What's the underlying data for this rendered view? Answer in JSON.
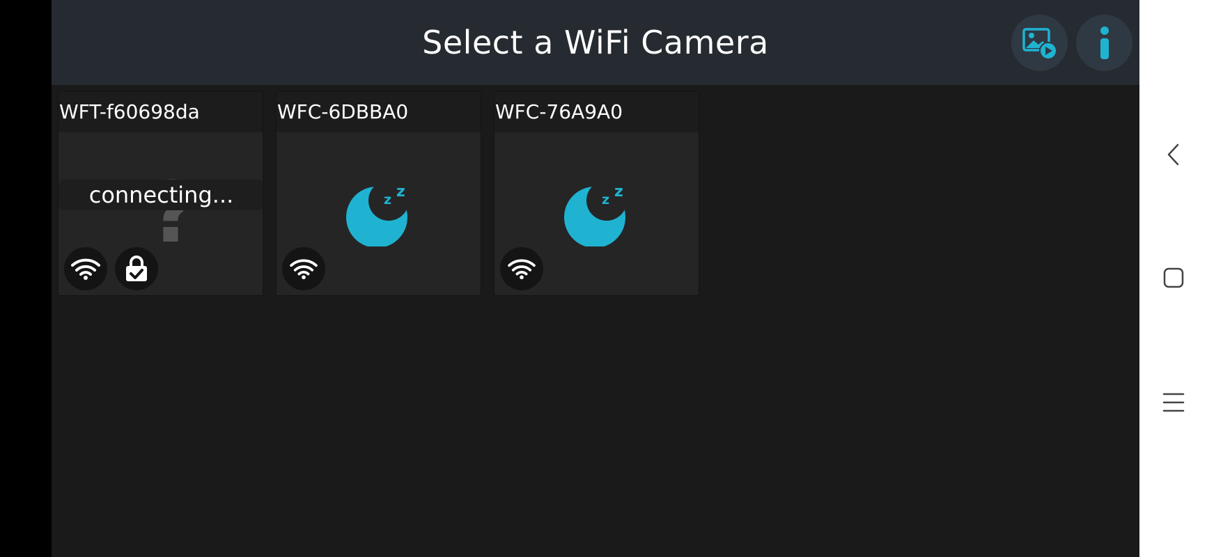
{
  "header": {
    "title": "Select a WiFi Camera",
    "gallery_icon": "gallery-play-icon",
    "info_icon": "info-icon"
  },
  "cameras": [
    {
      "name": "WFT-f60698da",
      "status": "connecting...",
      "state": "connecting",
      "icons": [
        "wifi-icon",
        "lock-check-icon"
      ]
    },
    {
      "name": "WFC-6DBBA0",
      "state": "sleeping",
      "icons": [
        "wifi-icon"
      ]
    },
    {
      "name": "WFC-76A9A0",
      "state": "sleeping",
      "icons": [
        "wifi-icon"
      ]
    }
  ],
  "system_nav": {
    "icons": [
      "back-icon",
      "home-icon",
      "recents-icon"
    ]
  },
  "colors": {
    "accent": "#1fb3d1",
    "header_bg": "#262b31",
    "app_bg": "#1a1a1a",
    "card_bg": "#252525"
  }
}
